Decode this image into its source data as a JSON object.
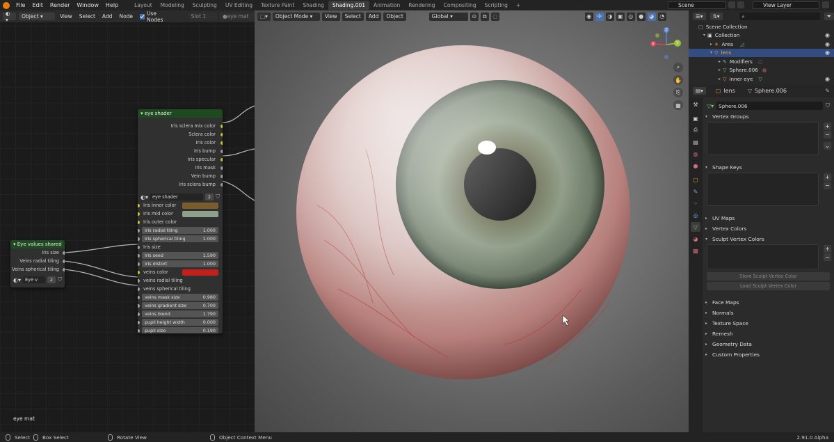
{
  "menu": {
    "items": [
      "File",
      "Edit",
      "Render",
      "Window",
      "Help"
    ]
  },
  "workspaces": [
    "Layout",
    "Modeling",
    "Sculpting",
    "UV Editing",
    "Texture Paint",
    "Shading",
    "Shading.001",
    "Animation",
    "Rendering",
    "Compositing",
    "Scripting"
  ],
  "workspace_add": "+",
  "active_workspace": "Shading.001",
  "scene": {
    "scene_label": "Scene",
    "view_layer_label": "View Layer"
  },
  "node_editor": {
    "mode": "Object",
    "view": "View",
    "select": "Select",
    "add": "Add",
    "node": "Node",
    "use_nodes": "Use Nodes",
    "slot": "Slot 1",
    "material": "eye mat",
    "footer_label": "eye mat",
    "eye_shader": {
      "title": "eye shader",
      "outputs": [
        "Iris sclera mix color",
        "Sclera color",
        "Iris color",
        "Iris bump",
        "Iris specular",
        "Iris mask",
        "Vein bump",
        "Iris sclera bump"
      ],
      "group_name": "eye shader",
      "group_users": "2",
      "color_inputs": [
        {
          "label": "Iris inner color",
          "color": "#7a5d2f"
        },
        {
          "label": "Iris mid color",
          "color": "#8fa08a"
        }
      ],
      "iris_outer": "Iris outer color",
      "fields1": [
        {
          "label": "Iris radial tiling",
          "value": "1.000"
        },
        {
          "label": "Iris spherical tiling",
          "value": "1.000"
        }
      ],
      "iris_size": "Iris size",
      "fields2": [
        {
          "label": "Iris seed",
          "value": "1.590"
        },
        {
          "label": "Iris distort",
          "value": "1.000"
        }
      ],
      "veins_color": {
        "label": "veins color",
        "color": "#c4201b"
      },
      "veins_radial": "veins radial tiling",
      "veins_spherical": "veins spherical tiling",
      "fields3": [
        {
          "label": "veins mask size",
          "value": "0.980"
        },
        {
          "label": "veins gradient size",
          "value": "0.700"
        },
        {
          "label": "veins blend",
          "value": "1.790"
        },
        {
          "label": "pupil height width",
          "value": "0.000"
        },
        {
          "label": "pupil size",
          "value": "0.190"
        }
      ]
    },
    "eye_values": {
      "title": "Eye values shared",
      "outputs": [
        "Iris size",
        "Veins radial tiling",
        "Veins spherical tiling"
      ],
      "group_name": "Eye v",
      "group_users": "2"
    }
  },
  "viewport": {
    "mode": "Object Mode",
    "view": "View",
    "select": "Select",
    "add": "Add",
    "object": "Object",
    "transform": "Global",
    "gizmo_x": "X",
    "gizmo_y": "Y",
    "gizmo_z": "Z"
  },
  "outliner": {
    "root": "Scene Collection",
    "items": [
      {
        "label": "Collection",
        "icon": "collection-icon",
        "level": 1
      },
      {
        "label": "Area",
        "icon": "light-icon",
        "level": 2
      },
      {
        "label": "lens",
        "icon": "mesh-icon",
        "level": 2
      },
      {
        "label": "Modifiers",
        "icon": "wrench-icon",
        "level": 3
      },
      {
        "label": "Sphere.006",
        "icon": "mesh-data-icon",
        "level": 3
      },
      {
        "label": "inner eye",
        "icon": "mesh-icon",
        "level": 3
      }
    ]
  },
  "properties": {
    "object": "lens",
    "data": "Sphere.006",
    "mesh_name": "Sphere.006",
    "panels": {
      "vertex_groups": "Vertex Groups",
      "shape_keys": "Shape Keys",
      "uv_maps": "UV Maps",
      "vertex_colors": "Vertex Colors",
      "sculpt_vertex_colors": "Sculpt Vertex Colors",
      "store": "Store Sculpt Vertex Color",
      "load": "Load Sculpt Vertex Color",
      "face_maps": "Face Maps",
      "normals": "Normals",
      "texture_space": "Texture Space",
      "remesh": "Remesh",
      "geometry_data": "Geometry Data",
      "custom_properties": "Custom Properties"
    }
  },
  "status": {
    "select": "Select",
    "box_select": "Box Select",
    "rotate_view": "Rotate View",
    "context_menu": "Object Context Menu",
    "version": "2.91.0 Alpha"
  }
}
